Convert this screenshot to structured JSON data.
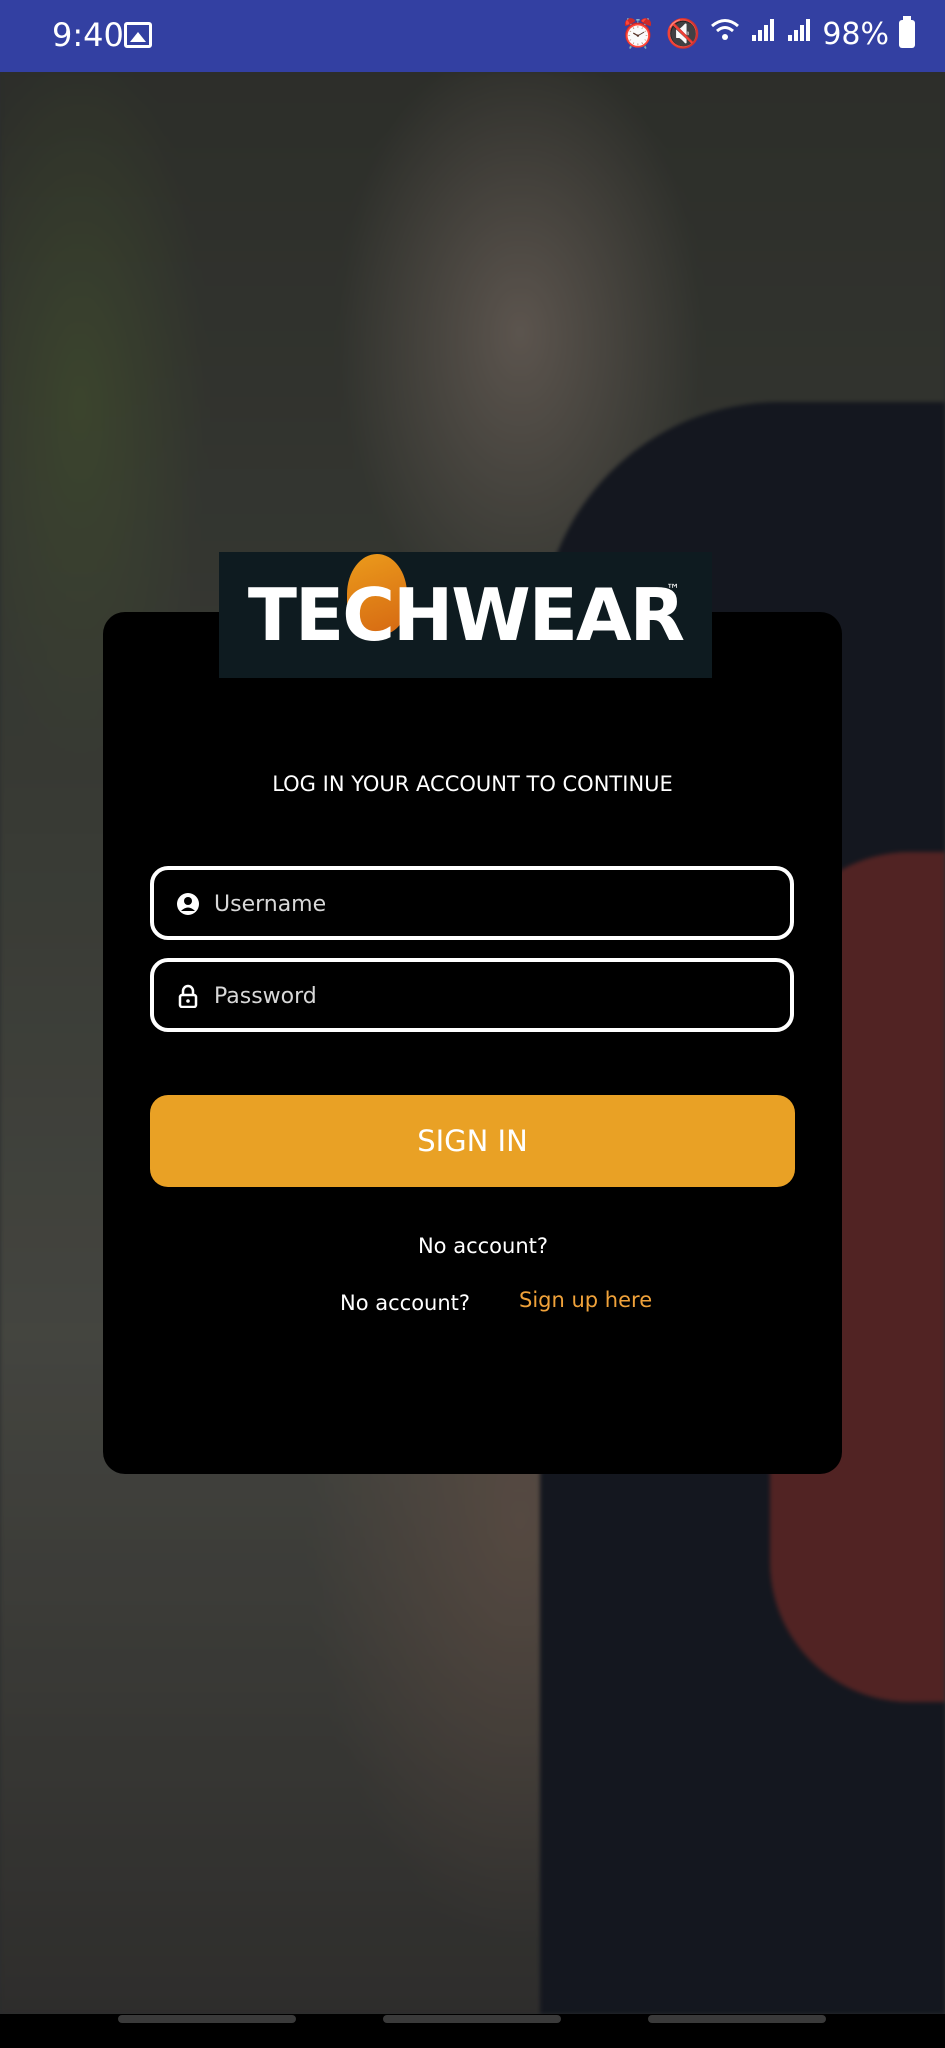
{
  "status_bar": {
    "time": "9:40",
    "battery": "98%",
    "icons": [
      "image-icon",
      "alarm-icon",
      "mute-icon",
      "wifi-icon",
      "signal-icon",
      "signal-icon",
      "battery-icon"
    ]
  },
  "logo": {
    "text": "TECHWEAR",
    "tm": "™"
  },
  "login": {
    "subtitle": "LOG IN YOUR ACCOUNT TO CONTINUE",
    "username_placeholder": "Username",
    "password_placeholder": "Password",
    "signin_label": "SIGN IN",
    "no_account_1": "No account?",
    "no_account_2": "No account?",
    "signup_link": "Sign up here"
  },
  "colors": {
    "status_bar": "#3340a2",
    "accent": "#e9a125",
    "link": "#f0a23a",
    "card": "#000000"
  }
}
